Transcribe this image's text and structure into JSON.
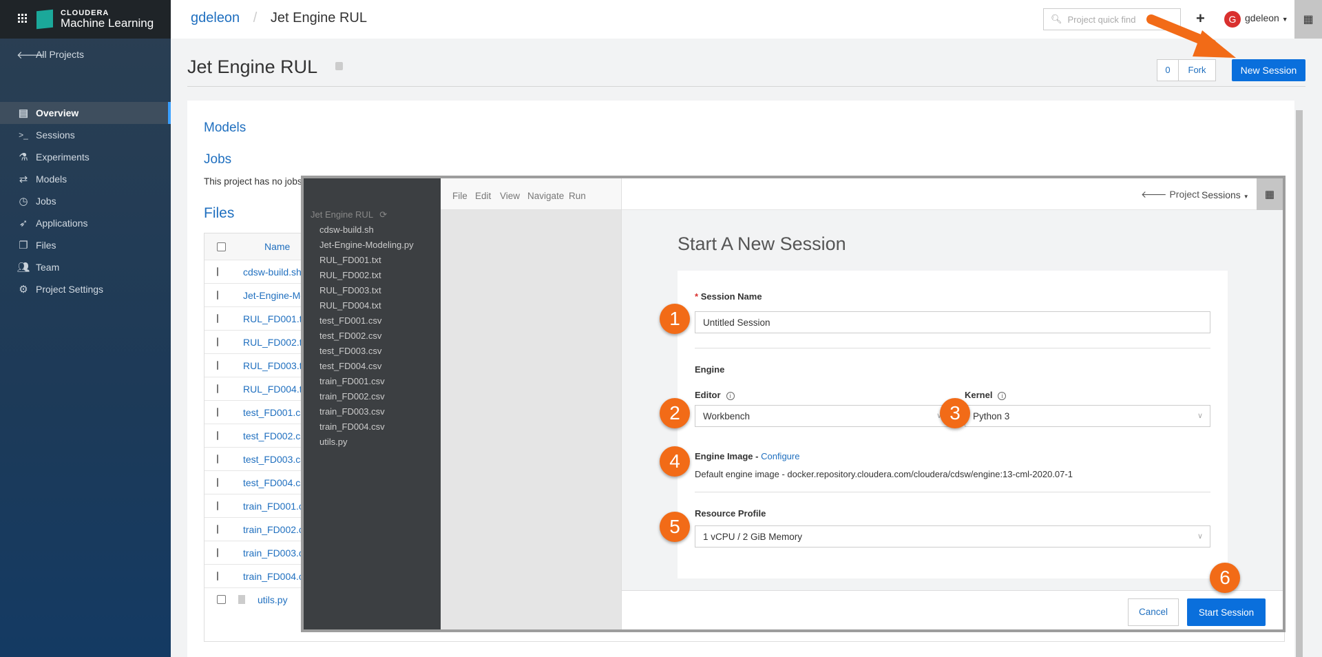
{
  "brand": {
    "company": "CLOUDERA",
    "product": "Machine Learning"
  },
  "sidebar": {
    "back": "All Projects",
    "items": [
      {
        "label": "Overview",
        "icon": "overview-icon",
        "active": true
      },
      {
        "label": "Sessions",
        "icon": "terminal-icon"
      },
      {
        "label": "Experiments",
        "icon": "flask-icon"
      },
      {
        "label": "Models",
        "icon": "arrows-icon"
      },
      {
        "label": "Jobs",
        "icon": "clock-icon"
      },
      {
        "label": "Applications",
        "icon": "rocket-icon"
      },
      {
        "label": "Files",
        "icon": "files-icon"
      },
      {
        "label": "Team",
        "icon": "team-icon"
      },
      {
        "label": "Project Settings",
        "icon": "gear-icon"
      }
    ]
  },
  "header": {
    "user_link": "gdeleon",
    "separator": "/",
    "project": "Jet Engine RUL",
    "search_placeholder": "Project quick find",
    "username": "gdeleon",
    "avatar_letter": "G"
  },
  "page": {
    "title": "Jet Engine RUL",
    "fork_count": "0",
    "fork_label": "Fork",
    "new_session": "New Session"
  },
  "overview": {
    "models_heading": "Models",
    "jobs_heading": "Jobs",
    "jobs_text": "This project has no jobs",
    "files_heading": "Files",
    "name_col": "Name",
    "files": [
      "cdsw-build.sh",
      "Jet-Engine-Modeling.py",
      "RUL_FD001.txt",
      "RUL_FD002.txt",
      "RUL_FD003.txt",
      "RUL_FD004.txt",
      "test_FD001.csv",
      "test_FD002.csv",
      "test_FD003.csv",
      "test_FD004.csv",
      "train_FD001.csv",
      "train_FD002.csv",
      "train_FD003.csv",
      "train_FD004.csv",
      "utils.py"
    ]
  },
  "workbench": {
    "project": "Jet Engine RUL",
    "menu": [
      "File",
      "Edit",
      "View",
      "Navigate",
      "Run"
    ],
    "project_link": "Project",
    "sessions_menu": "Sessions",
    "form": {
      "title": "Start A New Session",
      "session_name_label": "Session Name",
      "required_mark": "*",
      "session_name_value": "Untitled Session",
      "engine_heading": "Engine",
      "editor_label": "Editor",
      "editor_value": "Workbench",
      "kernel_label": "Kernel",
      "kernel_value": "Python 3",
      "engine_image_label": "Engine Image -",
      "configure_link": "Configure",
      "engine_image_text": "Default engine image - docker.repository.cloudera.com/cloudera/cdsw/engine:13-cml-2020.07-1",
      "resource_label": "Resource Profile",
      "resource_value": "1 vCPU / 2 GiB Memory",
      "cancel": "Cancel",
      "start": "Start Session"
    }
  },
  "annotations": {
    "steps": [
      "1",
      "2",
      "3",
      "4",
      "5",
      "6"
    ],
    "color": "#f26b17"
  },
  "colors": {
    "accent": "#0a6fdc",
    "link": "#1f6fbf"
  }
}
